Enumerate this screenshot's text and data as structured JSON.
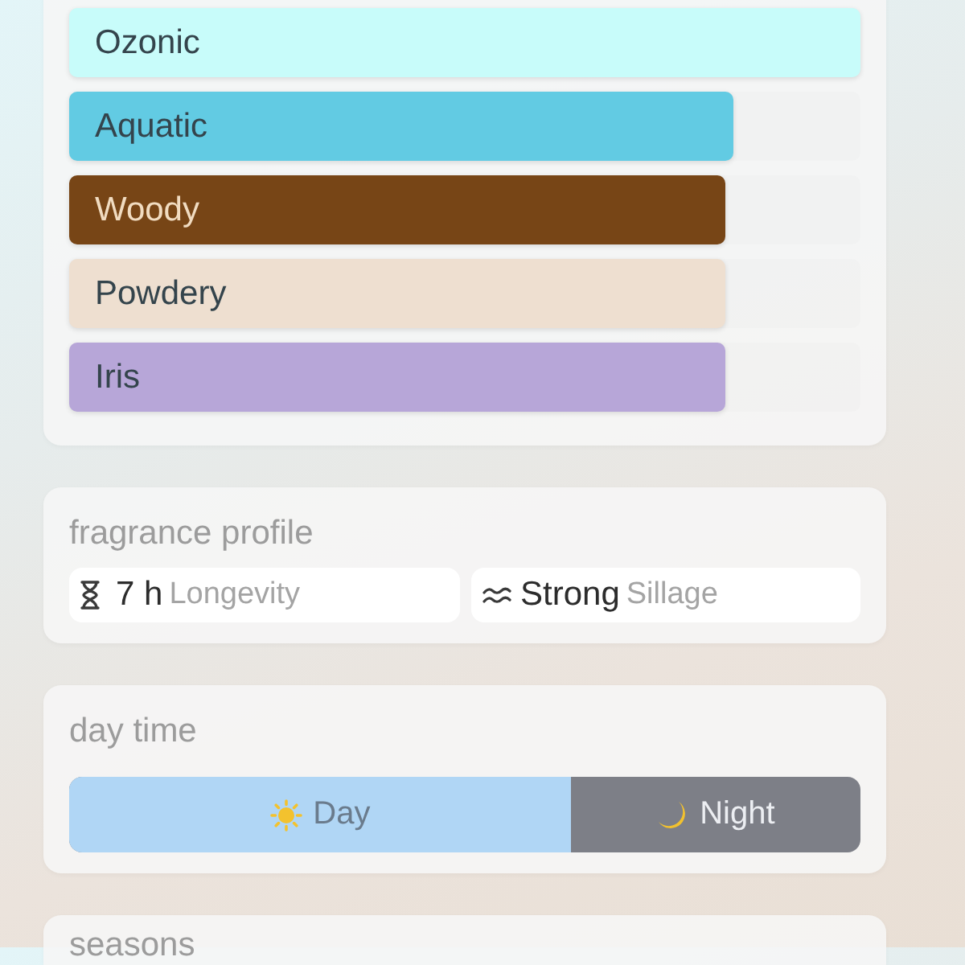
{
  "accords": [
    {
      "label": "Ozonic",
      "level": 1,
      "color": "#c8fcfa"
    },
    {
      "label": "Aquatic",
      "level": 0.84,
      "color": "#62cbe3"
    },
    {
      "label": "Woody",
      "level": 0.83,
      "color": "#774516"
    },
    {
      "label": "Powdery",
      "level": 0.83,
      "color": "#eedfd0"
    },
    {
      "label": "Iris",
      "level": 0.83,
      "color": "#b7a6d8"
    }
  ],
  "fragrance_profile": {
    "title": "fragrance profile",
    "stats": [
      {
        "kind": "hourglass",
        "value": "7 h",
        "label": "Longevity"
      },
      {
        "kind": "waves",
        "value": "Strong",
        "label": "Sillage"
      }
    ]
  },
  "day_time": {
    "title": "day time",
    "level": 0.634,
    "options": [
      {
        "kind": "day",
        "label": "Day"
      },
      {
        "kind": "night",
        "label": "Night"
      }
    ]
  },
  "seasons": {
    "title": "seasons"
  }
}
